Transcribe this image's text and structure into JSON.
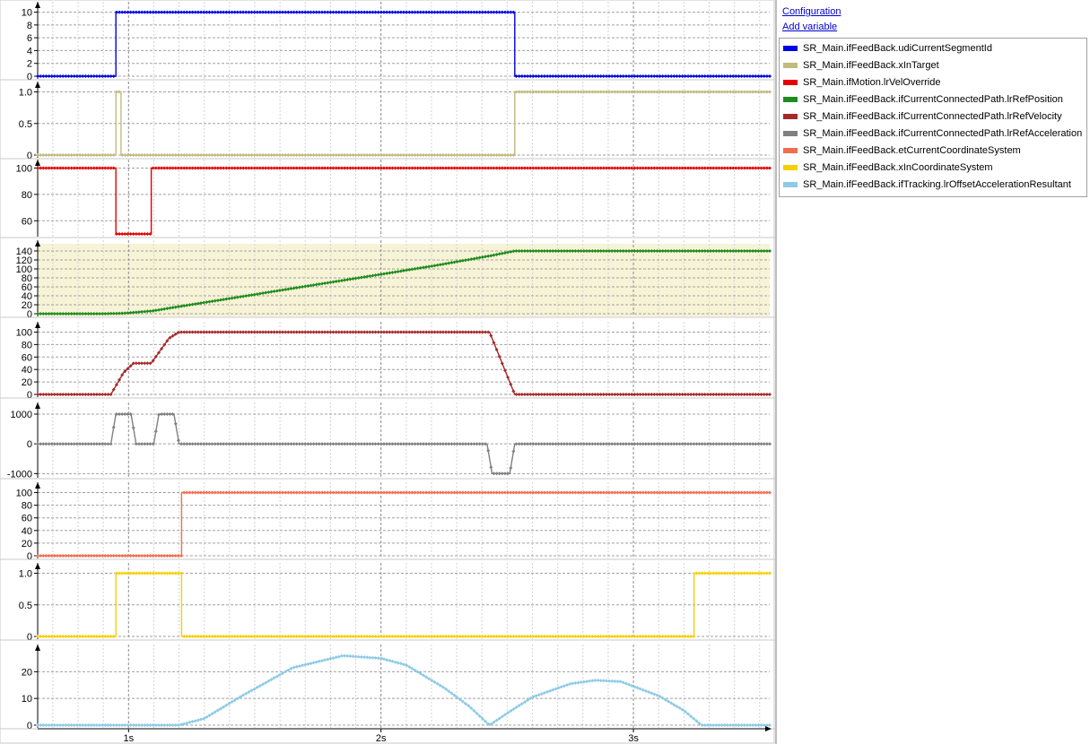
{
  "side_panel": {
    "configuration_link": "Configuration",
    "add_variable_link": "Add variable"
  },
  "legend": [
    {
      "name": "SR_Main.ifFeedBack.udiCurrentSegmentId",
      "color": "#0000e6"
    },
    {
      "name": "SR_Main.ifFeedBack.xInTarget",
      "color": "#c2ba7e"
    },
    {
      "name": "SR_Main.ifMotion.lrVelOverride",
      "color": "#e60000"
    },
    {
      "name": "SR_Main.ifFeedBack.ifCurrentConnectedPath.lrRefPosition",
      "color": "#1e8c1e"
    },
    {
      "name": "SR_Main.ifFeedBack.ifCurrentConnectedPath.lrRefVelocity",
      "color": "#a52a2a"
    },
    {
      "name": "SR_Main.ifFeedBack.ifCurrentConnectedPath.lrRefAcceleration",
      "color": "#808080"
    },
    {
      "name": "SR_Main.ifFeedBack.etCurrentCoordinateSystem",
      "color": "#f26d50"
    },
    {
      "name": "SR_Main.ifFeedBack.xInCoordinateSystem",
      "color": "#f5d000"
    },
    {
      "name": "SR_Main.ifFeedBack.ifTracking.lrOffsetAccelerationResultant",
      "color": "#8ecae6"
    }
  ],
  "chart_data": {
    "type": "line",
    "x_axis": {
      "label": "",
      "tick_labels": [
        "1s",
        "2s",
        "3s"
      ],
      "range": [
        0.64,
        3.54
      ]
    },
    "panels": [
      {
        "series": "SR_Main.ifFeedBack.udiCurrentSegmentId",
        "color": "#0000e6",
        "ylim": [
          0,
          10.5
        ],
        "ticks": [
          0,
          2,
          4,
          6,
          8,
          10
        ],
        "tick_labels": [
          "0",
          "2",
          "4",
          "6",
          "8",
          "10"
        ],
        "step": true,
        "highlight": false,
        "points": [
          [
            0.64,
            0
          ],
          [
            0.95,
            0
          ],
          [
            0.95,
            10
          ],
          [
            2.53,
            10
          ],
          [
            2.53,
            0
          ],
          [
            3.54,
            0
          ]
        ]
      },
      {
        "series": "SR_Main.ifFeedBack.xInTarget",
        "color": "#c2ba7e",
        "ylim": [
          0,
          1.05
        ],
        "ticks": [
          0,
          0.5,
          1
        ],
        "tick_labels": [
          "0",
          "0.5",
          "1.0"
        ],
        "step": true,
        "highlight": false,
        "points": [
          [
            0.64,
            0
          ],
          [
            0.95,
            0
          ],
          [
            0.95,
            1
          ],
          [
            0.97,
            1
          ],
          [
            0.97,
            0
          ],
          [
            2.53,
            0
          ],
          [
            2.53,
            1
          ],
          [
            3.54,
            1
          ]
        ]
      },
      {
        "series": "SR_Main.ifMotion.lrVelOverride",
        "color": "#e60000",
        "ylim": [
          50,
          101
        ],
        "ticks": [
          60,
          80,
          100
        ],
        "tick_labels": [
          "60",
          "80",
          "100"
        ],
        "step": true,
        "highlight": false,
        "points": [
          [
            0.64,
            100
          ],
          [
            0.95,
            100
          ],
          [
            0.95,
            50
          ],
          [
            1.09,
            50
          ],
          [
            1.09,
            100
          ],
          [
            3.54,
            100
          ]
        ]
      },
      {
        "series": "SR_Main.ifFeedBack.ifCurrentConnectedPath.lrRefPosition",
        "color": "#1e8c1e",
        "ylim": [
          0,
          148
        ],
        "ticks": [
          0,
          20,
          40,
          60,
          80,
          100,
          120,
          140
        ],
        "tick_labels": [
          "0",
          "20",
          "40",
          "60",
          "80",
          "100",
          "120",
          "140"
        ],
        "step": false,
        "highlight": true,
        "points": [
          [
            0.64,
            0
          ],
          [
            0.9,
            0
          ],
          [
            0.98,
            1
          ],
          [
            1.09,
            6
          ],
          [
            1.3,
            25
          ],
          [
            1.6,
            52
          ],
          [
            1.9,
            79
          ],
          [
            2.2,
            106
          ],
          [
            2.43,
            129
          ],
          [
            2.53,
            140
          ],
          [
            3.54,
            140
          ]
        ]
      },
      {
        "series": "SR_Main.ifFeedBack.ifCurrentConnectedPath.lrRefVelocity",
        "color": "#a52a2a",
        "ylim": [
          0,
          105
        ],
        "ticks": [
          0,
          20,
          40,
          60,
          80,
          100
        ],
        "tick_labels": [
          "0",
          "20",
          "40",
          "60",
          "80",
          "100"
        ],
        "step": false,
        "highlight": false,
        "points": [
          [
            0.64,
            0
          ],
          [
            0.93,
            0
          ],
          [
            0.98,
            35
          ],
          [
            1.02,
            50
          ],
          [
            1.09,
            50
          ],
          [
            1.16,
            90
          ],
          [
            1.2,
            100
          ],
          [
            2.43,
            100
          ],
          [
            2.53,
            0
          ],
          [
            3.54,
            0
          ]
        ]
      },
      {
        "series": "SR_Main.ifFeedBack.ifCurrentConnectedPath.lrRefAcceleration",
        "color": "#808080",
        "ylim": [
          -1050,
          1150
        ],
        "ticks": [
          -1000,
          0,
          1000
        ],
        "tick_labels": [
          "-1000",
          "0",
          "1000"
        ],
        "step": false,
        "highlight": false,
        "points": [
          [
            0.64,
            0
          ],
          [
            0.93,
            0
          ],
          [
            0.95,
            1000
          ],
          [
            1.01,
            1000
          ],
          [
            1.03,
            0
          ],
          [
            1.1,
            0
          ],
          [
            1.12,
            1000
          ],
          [
            1.18,
            1000
          ],
          [
            1.2,
            0
          ],
          [
            2.42,
            0
          ],
          [
            2.44,
            -1000
          ],
          [
            2.51,
            -1000
          ],
          [
            2.53,
            0
          ],
          [
            3.54,
            0
          ]
        ]
      },
      {
        "series": "SR_Main.ifFeedBack.etCurrentCoordinateSystem",
        "color": "#f26d50",
        "ylim": [
          0,
          105
        ],
        "ticks": [
          0,
          20,
          40,
          60,
          80,
          100
        ],
        "tick_labels": [
          "0",
          "20",
          "40",
          "60",
          "80",
          "100"
        ],
        "step": true,
        "highlight": false,
        "points": [
          [
            0.64,
            0
          ],
          [
            1.21,
            0
          ],
          [
            1.21,
            100
          ],
          [
            3.54,
            100
          ]
        ]
      },
      {
        "series": "SR_Main.ifFeedBack.xInCoordinateSystem",
        "color": "#f5d000",
        "ylim": [
          0,
          1.05
        ],
        "ticks": [
          0,
          0.5,
          1
        ],
        "tick_labels": [
          "0",
          "0.5",
          "1.0"
        ],
        "step": true,
        "highlight": false,
        "points": [
          [
            0.64,
            0
          ],
          [
            0.95,
            0
          ],
          [
            0.95,
            1
          ],
          [
            1.21,
            1
          ],
          [
            1.21,
            0
          ],
          [
            3.24,
            0
          ],
          [
            3.24,
            1
          ],
          [
            3.54,
            1
          ]
        ]
      },
      {
        "series": "SR_Main.ifFeedBack.ifTracking.lrOffsetAccelerationResultant",
        "color": "#8ecae6",
        "ylim": [
          0,
          27.5
        ],
        "ticks": [
          0,
          10,
          20
        ],
        "tick_labels": [
          "0",
          "10",
          "20"
        ],
        "step": false,
        "highlight": false,
        "points": [
          [
            0.64,
            0
          ],
          [
            1.2,
            0
          ],
          [
            1.3,
            2.5
          ],
          [
            1.45,
            11
          ],
          [
            1.65,
            21.5
          ],
          [
            1.85,
            26
          ],
          [
            2.0,
            25
          ],
          [
            2.1,
            22.5
          ],
          [
            2.25,
            14
          ],
          [
            2.35,
            7
          ],
          [
            2.43,
            0
          ],
          [
            2.5,
            4.5
          ],
          [
            2.6,
            10.5
          ],
          [
            2.75,
            15.5
          ],
          [
            2.85,
            16.8
          ],
          [
            2.95,
            16.3
          ],
          [
            3.1,
            11
          ],
          [
            3.2,
            5.5
          ],
          [
            3.27,
            0
          ],
          [
            3.54,
            0
          ]
        ]
      }
    ]
  }
}
